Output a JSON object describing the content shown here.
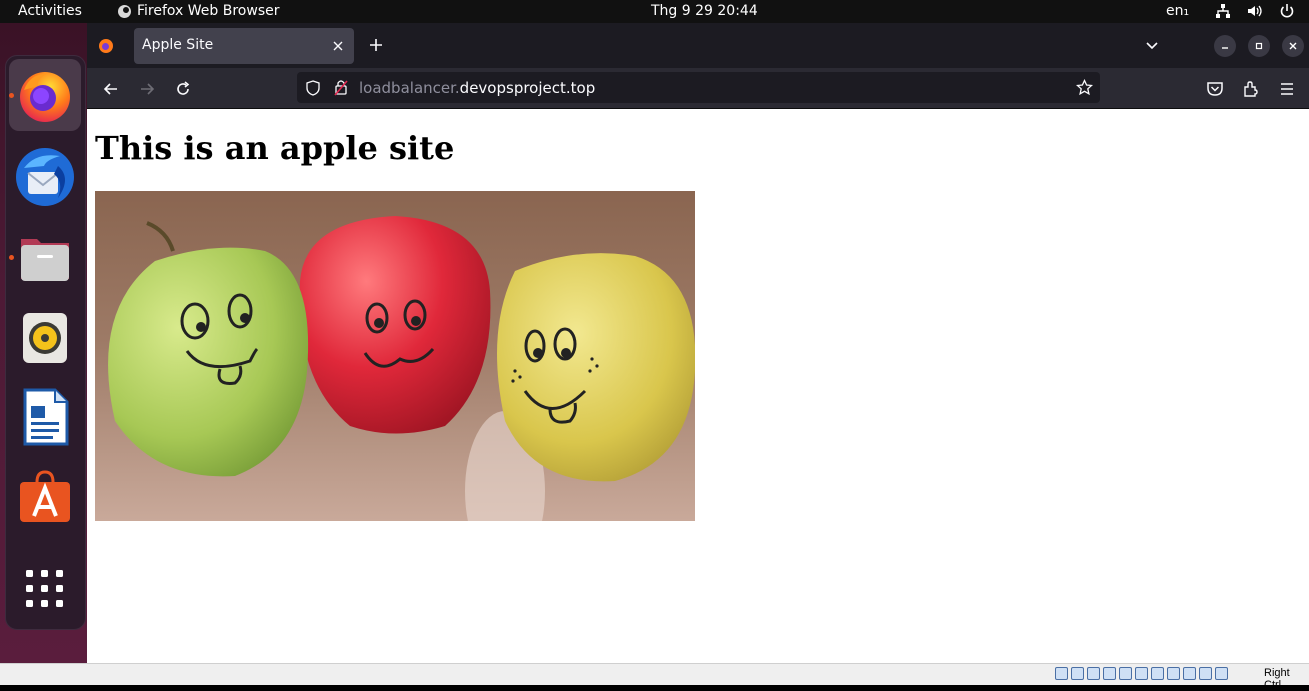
{
  "system": {
    "activities_label": "Activities",
    "app_name": "Firefox Web Browser",
    "clock": "Thg 9 29  20:44",
    "input_language": "en₁",
    "tray_icons": [
      "network-icon",
      "volume-icon",
      "power-icon"
    ]
  },
  "dock": {
    "items": [
      {
        "name": "dock-firefox",
        "icon": "firefox-icon",
        "running": true,
        "active": true
      },
      {
        "name": "dock-thunderbird",
        "icon": "thunderbird-icon",
        "running": false
      },
      {
        "name": "dock-files",
        "icon": "files-icon",
        "running": true
      },
      {
        "name": "dock-rhythmbox",
        "icon": "rhythmbox-icon",
        "running": false
      },
      {
        "name": "dock-libreoffice-writer",
        "icon": "writer-icon",
        "running": false
      },
      {
        "name": "dock-app-center",
        "icon": "app-center-icon",
        "running": false
      },
      {
        "name": "dock-show-apps",
        "icon": "grid-icon",
        "running": false
      }
    ]
  },
  "browser": {
    "tabs": [
      {
        "title": "Apple Site",
        "active": true
      }
    ],
    "url": {
      "subdomain": "loadbalancer.",
      "host": "devopsproject.top"
    }
  },
  "page": {
    "heading": "This is an apple site",
    "image": {
      "subject": "three apples with drawn faces",
      "colors": [
        "#9cc248",
        "#d92b35",
        "#d9c14a"
      ]
    }
  },
  "vbox": {
    "host_key_label": "Right Ctrl"
  },
  "colors": {
    "accent": "#e95420",
    "tab_bg": "#42414d",
    "toolbar_bg": "#2b2a33",
    "tabstrip_bg": "#1c1b22"
  }
}
